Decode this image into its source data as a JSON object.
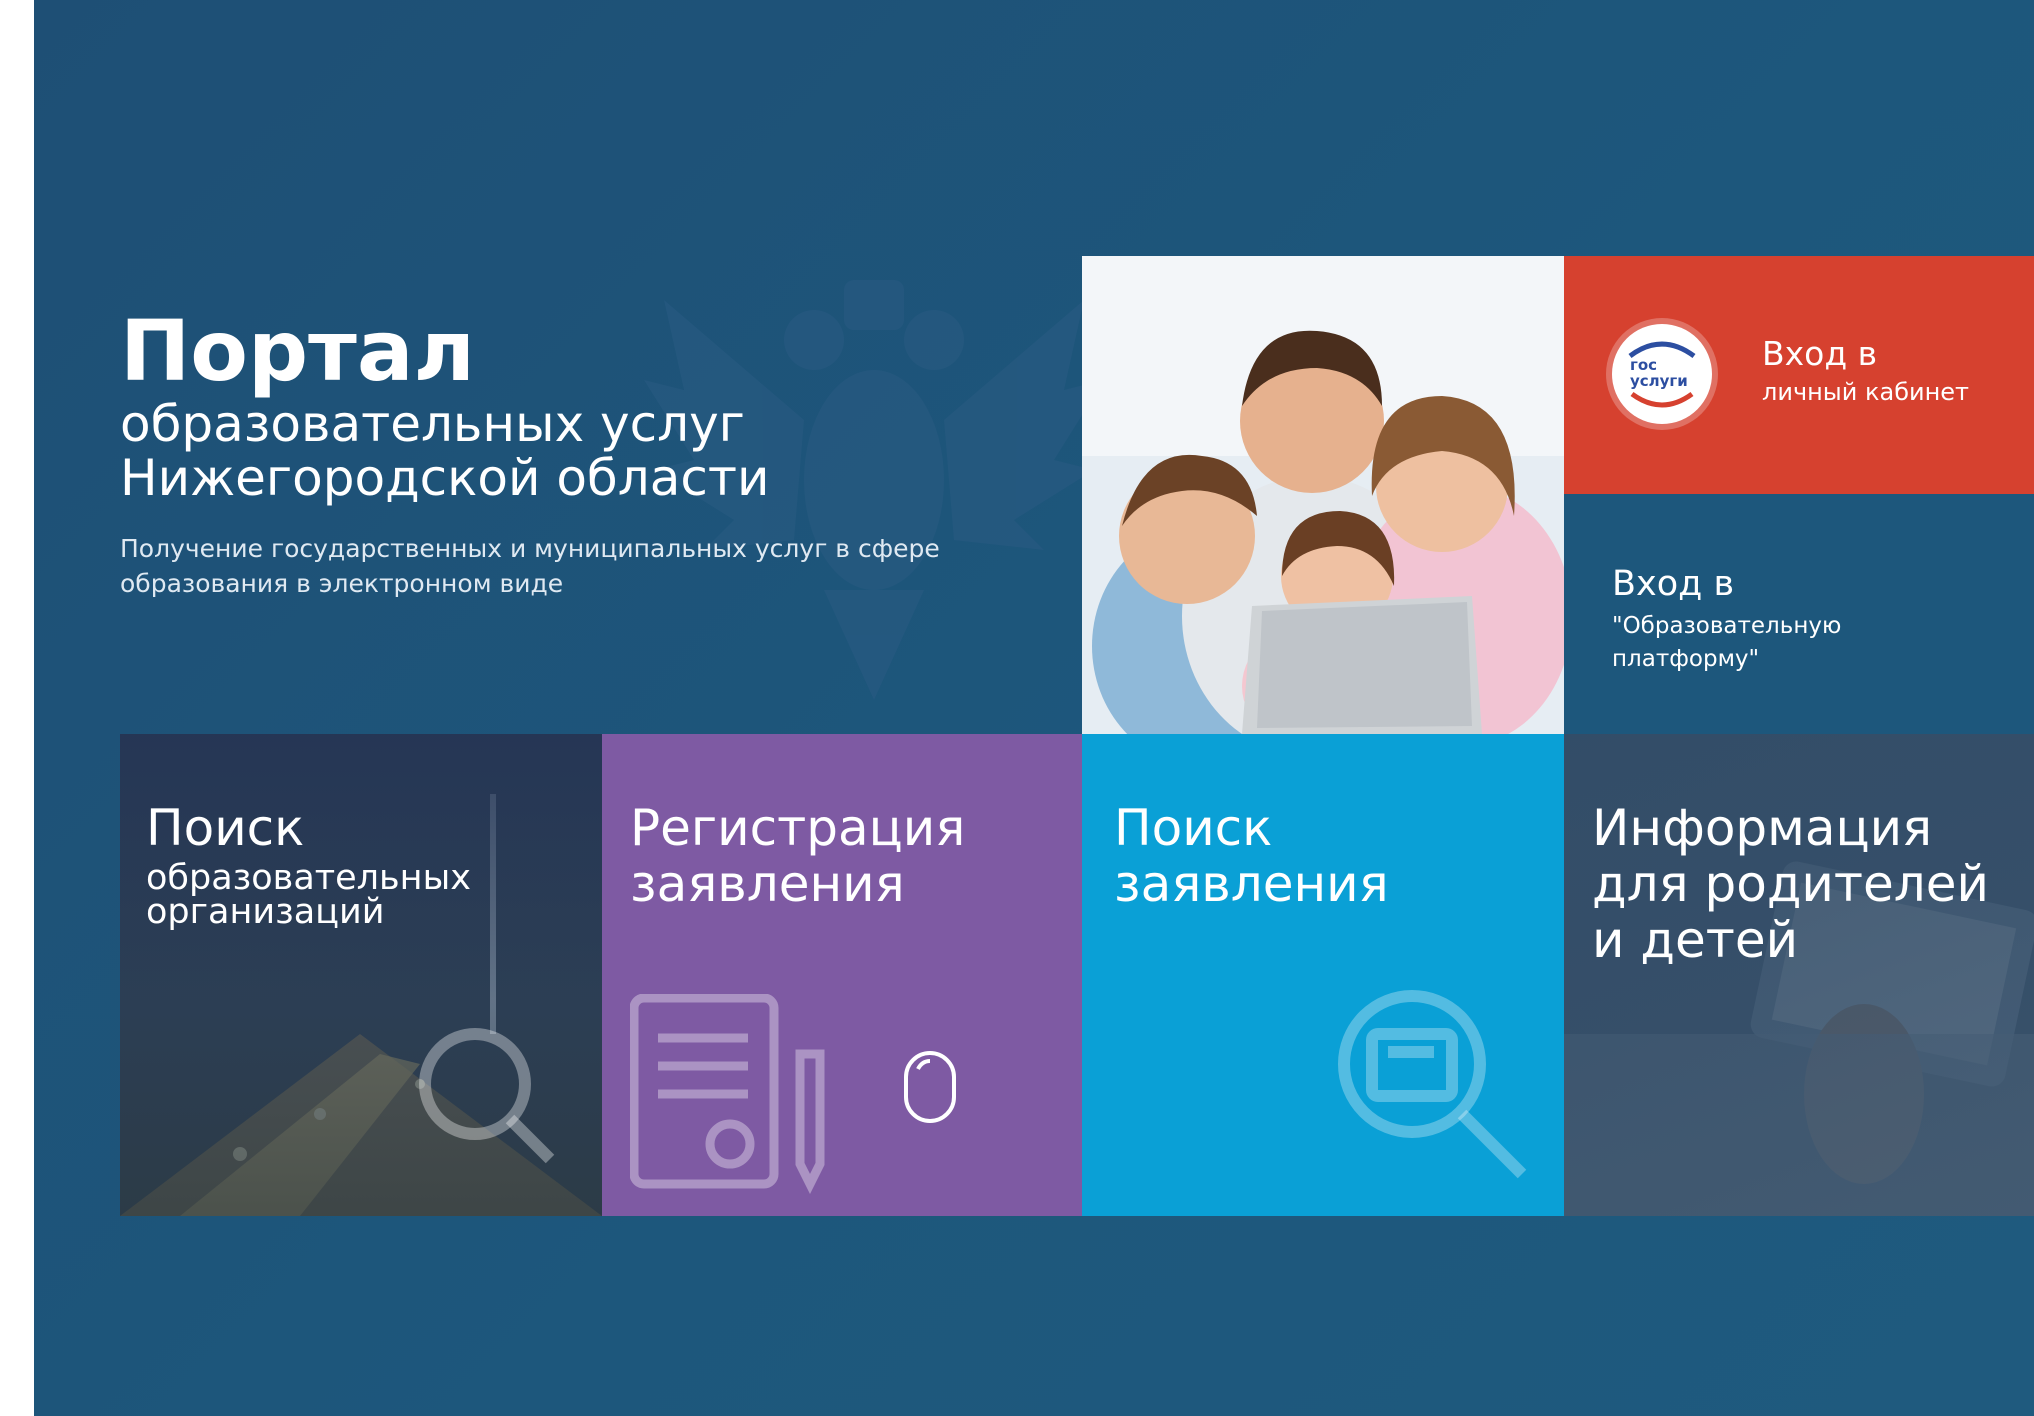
{
  "hero": {
    "title": "Портал",
    "subtitle_line1": "образовательных услуг",
    "subtitle_line2": "Нижегородской области",
    "description_line1": "Получение государственных и муниципальных услуг в сфере",
    "description_line2": "образования в электронном виде"
  },
  "login_gosuslugi": {
    "logo_text_top": "гос",
    "logo_text_bottom": "услуги",
    "title": "Вход в",
    "subtitle": "личный кабинет"
  },
  "login_edu_platform": {
    "title": "Вход в",
    "subtitle_line1": "\"Образовательную",
    "subtitle_line2": "платформу\""
  },
  "tiles": {
    "search_org": {
      "title": "Поиск",
      "line1": "образовательных",
      "line2": "организаций"
    },
    "register": {
      "line1": "Регистрация",
      "line2": "заявления"
    },
    "search_app": {
      "line1": "Поиск",
      "line2": "заявления"
    },
    "info": {
      "line1": "Информация",
      "line2": "для родителей",
      "line3": "и детей"
    }
  },
  "colors": {
    "background": "#1e5276",
    "gosuslugi_red": "#d6412f",
    "register_purple": "#7e5aa3",
    "search_blue": "#0aa0d6"
  }
}
